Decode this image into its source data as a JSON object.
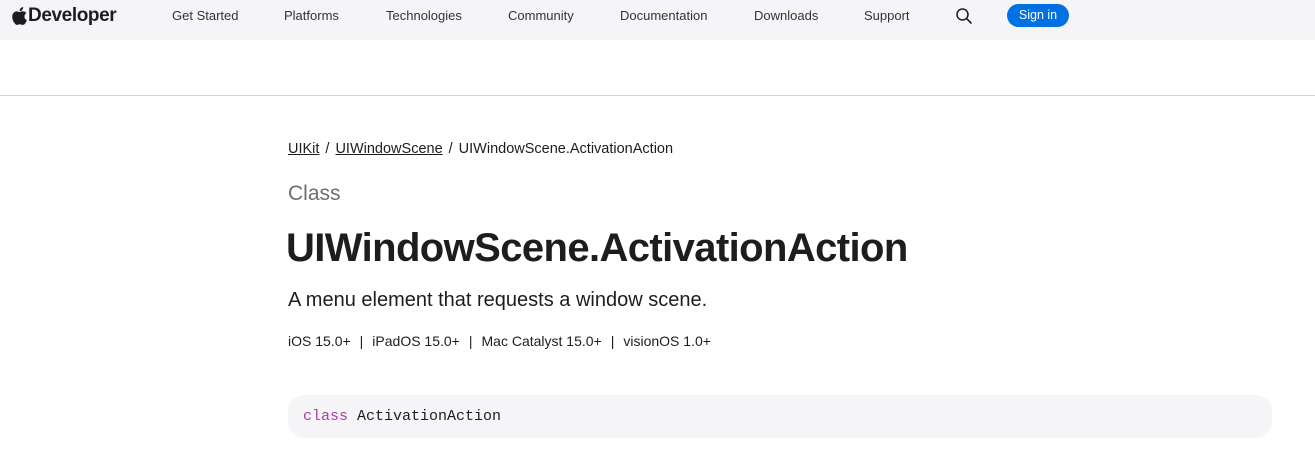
{
  "global_nav": {
    "brand": "Developer",
    "items": [
      {
        "label": "Get Started"
      },
      {
        "label": "Platforms"
      },
      {
        "label": "Technologies"
      },
      {
        "label": "Community"
      },
      {
        "label": "Documentation"
      },
      {
        "label": "Downloads"
      },
      {
        "label": "Support"
      }
    ],
    "search_icon": "search-icon",
    "sign_in_label": "Sign in"
  },
  "breadcrumb": {
    "items": [
      {
        "label": "UIKit",
        "link": true
      },
      {
        "label": "UIWindowScene",
        "link": true
      },
      {
        "label": "UIWindowScene.ActivationAction",
        "link": false
      }
    ],
    "separator": "/"
  },
  "page": {
    "kicker": "Class",
    "title": "UIWindowScene.ActivationAction",
    "abstract": "A menu element that requests a window scene.",
    "platforms": [
      {
        "label": "iOS 15.0+"
      },
      {
        "label": "iPadOS 15.0+"
      },
      {
        "label": "Mac Catalyst 15.0+"
      },
      {
        "label": "visionOS 1.0+"
      }
    ],
    "platform_separator": "|"
  },
  "declaration": {
    "keyword": "class",
    "name": "ActivationAction"
  },
  "colors": {
    "accent": "#0071e3",
    "keyword": "#ad3da4",
    "nav_background": "#f5f5f7"
  }
}
